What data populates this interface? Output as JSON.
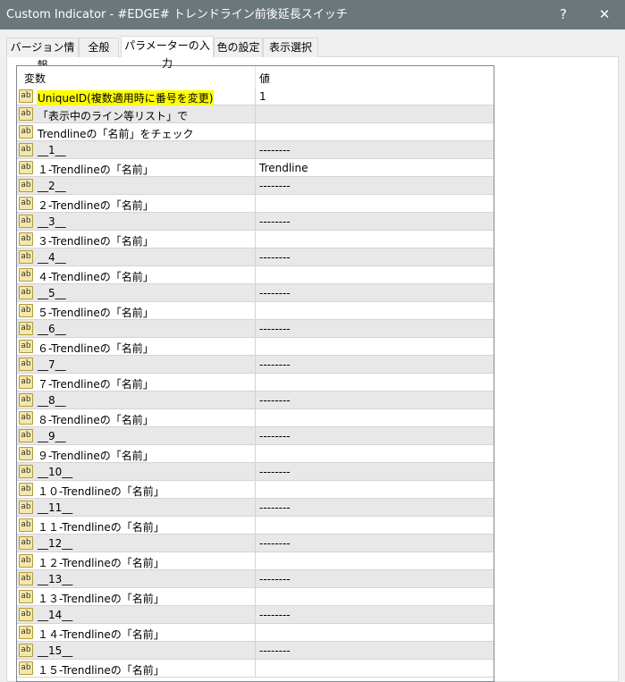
{
  "window": {
    "title": "Custom Indicator - #EDGE# トレンドライン前後延長スイッチ",
    "help": "?",
    "close": "✕"
  },
  "tabs": [
    {
      "label": "バージョン情報"
    },
    {
      "label": "全般"
    },
    {
      "label": "パラメーターの入力",
      "active": true
    },
    {
      "label": "色の設定"
    },
    {
      "label": "表示選択"
    }
  ],
  "table": {
    "headers": {
      "variable": "変数",
      "value": "値"
    },
    "icon_label": "ab",
    "rows": [
      {
        "name": "UniqueID(複数適用時に番号を変更)",
        "value": "1",
        "highlight": true
      },
      {
        "name": "「表示中のライン等リスト」で",
        "value": ""
      },
      {
        "name": "Trendlineの「名前」をチェック",
        "value": ""
      },
      {
        "name": "__1__",
        "value": "--------"
      },
      {
        "name": "１-Trendlineの「名前」",
        "value": "Trendline"
      },
      {
        "name": "__2__",
        "value": "--------"
      },
      {
        "name": "２-Trendlineの「名前」",
        "value": ""
      },
      {
        "name": "__3__",
        "value": "--------"
      },
      {
        "name": "３-Trendlineの「名前」",
        "value": ""
      },
      {
        "name": "__4__",
        "value": "--------"
      },
      {
        "name": "４-Trendlineの「名前」",
        "value": ""
      },
      {
        "name": "__5__",
        "value": "--------"
      },
      {
        "name": "５-Trendlineの「名前」",
        "value": ""
      },
      {
        "name": "__6__",
        "value": "--------"
      },
      {
        "name": "６-Trendlineの「名前」",
        "value": ""
      },
      {
        "name": "__7__",
        "value": "--------"
      },
      {
        "name": "７-Trendlineの「名前」",
        "value": ""
      },
      {
        "name": "__8__",
        "value": "--------"
      },
      {
        "name": "８-Trendlineの「名前」",
        "value": ""
      },
      {
        "name": "__9__",
        "value": "--------"
      },
      {
        "name": "９-Trendlineの「名前」",
        "value": ""
      },
      {
        "name": "__10__",
        "value": "--------"
      },
      {
        "name": "１０-Trendlineの「名前」",
        "value": ""
      },
      {
        "name": "__11__",
        "value": "--------"
      },
      {
        "name": "１１-Trendlineの「名前」",
        "value": ""
      },
      {
        "name": "__12__",
        "value": "--------"
      },
      {
        "name": "１２-Trendlineの「名前」",
        "value": ""
      },
      {
        "name": "__13__",
        "value": "--------"
      },
      {
        "name": "１３-Trendlineの「名前」",
        "value": ""
      },
      {
        "name": "__14__",
        "value": "--------"
      },
      {
        "name": "１４-Trendlineの「名前」",
        "value": ""
      },
      {
        "name": "__15__",
        "value": "--------"
      },
      {
        "name": "１５-Trendlineの「名前」",
        "value": ""
      }
    ]
  }
}
